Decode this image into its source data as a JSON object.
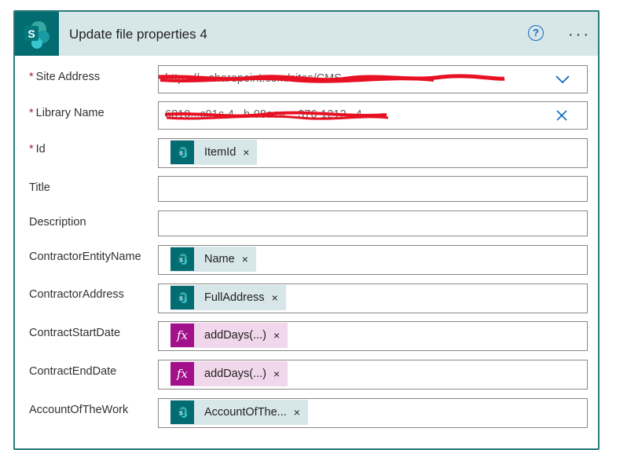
{
  "action": {
    "title": "Update file properties 4",
    "help_icon": "?",
    "more_icon": "···"
  },
  "fields": [
    {
      "label": "Site Address",
      "required": true,
      "value": "https://...sharepoint.com/sites/CMS",
      "control": "dropdown"
    },
    {
      "label": "Library Name",
      "required": true,
      "value": "6810...c91c-4...b-98ae-c...376-1212...4",
      "control": "clear"
    },
    {
      "label": "Id",
      "required": true,
      "token": {
        "type": "sharepoint",
        "label": "ItemId"
      }
    },
    {
      "label": "Title",
      "required": false
    },
    {
      "label": "Description",
      "required": false
    },
    {
      "label": "ContractorEntityName",
      "required": false,
      "token": {
        "type": "sharepoint",
        "label": "Name"
      }
    },
    {
      "label": "ContractorAddress",
      "required": false,
      "token": {
        "type": "sharepoint",
        "label": "FullAddress"
      }
    },
    {
      "label": "ContractStartDate",
      "required": false,
      "token": {
        "type": "expression",
        "label": "addDays(...)"
      }
    },
    {
      "label": "ContractEndDate",
      "required": false,
      "token": {
        "type": "expression",
        "label": "addDays(...)"
      }
    },
    {
      "label": "AccountOfTheWork",
      "required": false,
      "token": {
        "type": "sharepoint",
        "label": "AccountOfThe..."
      }
    }
  ],
  "required_mark": "*",
  "token_remove": "×",
  "fx_glyph": "fx",
  "colors": {
    "header_bg": "#d7e6e9",
    "sharepoint": "#036c70",
    "expression": "#a2118b",
    "expression_token_bg": "#f1d7eb",
    "accent": "#0f6cbd",
    "redaction": "#e81123"
  }
}
